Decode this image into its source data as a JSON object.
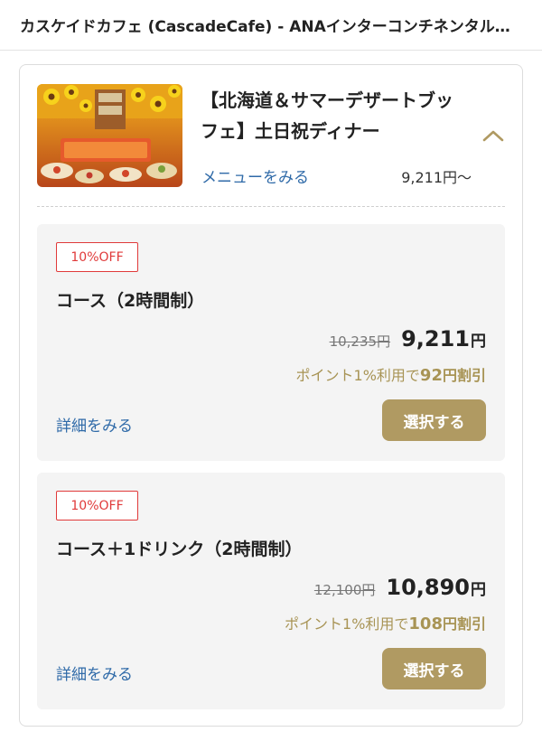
{
  "header": {
    "title": "カスケイドカフェ (CascadeCafe) - ANAインターコンチネンタルホテル東京"
  },
  "plan": {
    "thumbnail_icon": "summer-buffet-photo",
    "title_line1": "【北海道＆サマーデザートブッ",
    "title_line2": "フェ】土日祝ディナー",
    "menu_link": "メニューをみる",
    "from_price": "9,211円〜",
    "chevron_icon": "chevron-up-icon"
  },
  "courses": [
    {
      "badge": "10%OFF",
      "name": "コース（2時間制）",
      "original_price": "10,235円",
      "price": "9,211",
      "price_unit": "円",
      "point_prefix": "ポイント1%利用で",
      "point_amount": "92",
      "point_suffix": "円割引",
      "detail_link": "詳細をみる",
      "select_label": "選択する"
    },
    {
      "badge": "10%OFF",
      "name": "コース＋1ドリンク（2時間制）",
      "original_price": "12,100円",
      "price": "10,890",
      "price_unit": "円",
      "point_prefix": "ポイント1%利用で",
      "point_amount": "108",
      "point_suffix": "円割引",
      "detail_link": "詳細をみる",
      "select_label": "選択する"
    }
  ],
  "colors": {
    "accent_gold": "#b09a62",
    "link_blue": "#2f6aa8",
    "badge_red": "#e03a3a"
  }
}
